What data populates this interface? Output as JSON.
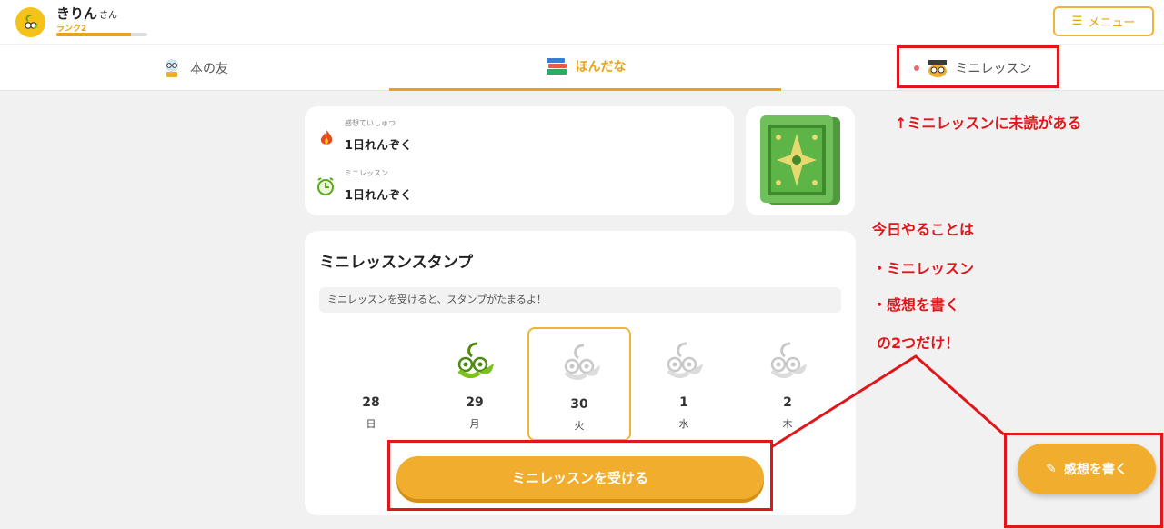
{
  "user": {
    "name": "きりん",
    "honorific": "さん",
    "rank": "ランク2",
    "rank_progress": 0.82
  },
  "menu": {
    "label": "メニュー",
    "icon": "hamburger-icon"
  },
  "tabs": [
    {
      "label": "本の友",
      "icon": "book-friend-icon"
    },
    {
      "label": "ほんだな",
      "icon": "bookshelf-icon",
      "active": true
    },
    {
      "label": "ミニレッスン",
      "icon": "owl-icon",
      "unread": true
    }
  ],
  "streaks": {
    "impression": {
      "label": "感想ていしゅつ",
      "value": "1日れんぞく",
      "icon": "flame-icon"
    },
    "lesson": {
      "label": "ミニレッスン",
      "value": "1日れんぞく",
      "icon": "alarm-clock-icon"
    }
  },
  "stamp": {
    "title": "ミニレッスンスタンプ",
    "hint": "ミニレッスンを受けると、スタンプがたまるよ！",
    "days": [
      {
        "num": "28",
        "wd": "日",
        "stamp": "none"
      },
      {
        "num": "29",
        "wd": "月",
        "stamp": "done"
      },
      {
        "num": "30",
        "wd": "火",
        "stamp": "pending",
        "today": true
      },
      {
        "num": "1",
        "wd": "水",
        "stamp": "pending"
      },
      {
        "num": "2",
        "wd": "木",
        "stamp": "pending"
      }
    ]
  },
  "cta": {
    "label": "ミニレッスンを受ける"
  },
  "fab": {
    "label": "感想を書く",
    "icon": "pencil-icon"
  },
  "annotations": {
    "unread": "↑ミニレッスンに未読がある",
    "today_line1": "今日やることは",
    "today_line2": "・ミニレッスン",
    "today_line3": "・感想を書く",
    "today_line4": "の2つだけ！"
  },
  "colors": {
    "accent": "#f0ad2e",
    "annotation_red": "#e0161b",
    "stamp_green": "#7cc11e"
  }
}
